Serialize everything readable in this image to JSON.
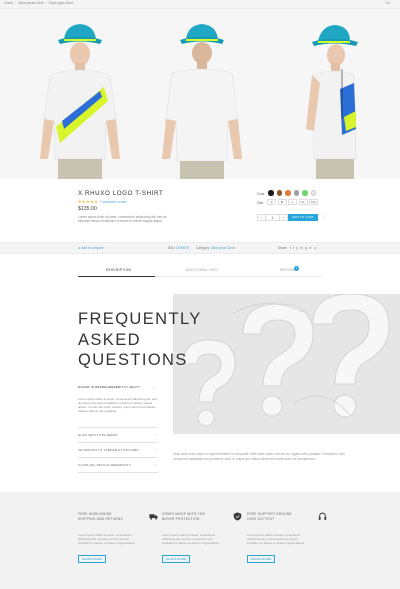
{
  "breadcrumb": {
    "items": [
      "Home",
      "Ultra Ipsum Dent",
      "Tulpa Ipgis Dent"
    ],
    "right_text": "1/4"
  },
  "product": {
    "title": "X RHUXO LOGO T-SHIRT",
    "stars": "★★★★★",
    "reviews": "1 customer review",
    "price": "$135.00",
    "description": "Lorem ipsum dolor sit amet, consectetur adipisicing elit, sed do eiusmod tempor incididunt ut labore et dolore magna aliqua.",
    "colors_label": "Color",
    "colors": [
      "#1a1a1a",
      "#8a5a2b",
      "#e07b3a",
      "#9aa0a6",
      "#6fd36b",
      "#e7e7e7"
    ],
    "sizes_label": "Size",
    "sizes": [
      "S",
      "M",
      "L",
      "XL",
      "XXL"
    ],
    "qty_minus": "−",
    "qty_value": "1",
    "qty_plus": "+",
    "add_to_cart": "ADD TO CART",
    "wishlist_icon": "♡"
  },
  "meta": {
    "compare": "⊕ Add to compare",
    "sku_label": "SKU:",
    "sku_value": "IXR0075",
    "category_label": "Category:",
    "category_value": "Ultra Ipsum Dent",
    "share_label": "Share:",
    "share_icons": [
      "f",
      "t",
      "p",
      "in",
      "g",
      "✉",
      "◎"
    ]
  },
  "tabs": {
    "items": [
      "DESCRIPTION",
      "ADDITIONAL INFO",
      "REVIEWS"
    ],
    "reviews_count": "1"
  },
  "faq": {
    "title_lines": [
      "FREQUENTLY",
      "ASKED",
      "QUESTIONS"
    ],
    "questions": [
      {
        "q": "DOLOR IN REPREHENDERIT IN VELIT?",
        "chevron": "⌄"
      },
      {
        "q": "ELAM VENI TOTE DEMO?",
        "chevron": "›"
      },
      {
        "q": "INCIDIDUNT UT LABORE ET DOLORE?",
        "chevron": "›"
      },
      {
        "q": "CULPA QUI OFFICIA DESERUNT?",
        "chevron": "›"
      }
    ],
    "answer": "Lorem ipsum dolor sit amet, consectetur adipiscing elit, sed do eiusmod tempor incididunt ut labore et dolore magna aliqua. Ut enim ad minim veniam, quis nostrud exercitation ullamco laboris nisi ut aliquip.",
    "body_text": "Duis aute irure dolor in reprehenderit in voluptate velit esse cillum dolore eu fugiat nulla pariatur. Excepteur sint occaecat cupidatat non proident, sunt in culpa qui officia deserunt mollit anim id est laborum."
  },
  "features": [
    {
      "title": "FREE WORLDWIDE SHIPPING AND RETURNS",
      "icon": "truck-icon",
      "desc": "Lorem ipsum dolor sit amet, consectetur adipiscing elit, sed do eiusmod tempor incididunt ut labore et dolore magna aliqua.",
      "button": "LEARN MORE"
    },
    {
      "title": "COMPLIANCE WITH THE BUYER PROTECTION",
      "icon": "shield-icon",
      "desc": "Lorem ipsum dolor sit amet, consectetur adipiscing elit, sed do eiusmod tempor incididunt ut labore et dolore magna aliqua.",
      "button": "LEARN MORE"
    },
    {
      "title": "FREE SUPPORT AROUND 24/00 24/7 EXIT",
      "icon": "headset-icon",
      "desc": "Lorem ipsum dolor sit amet, consectetur adipiscing elit, sed do eiusmod tempor incididunt ut labore et dolore magna aliqua.",
      "button": "LEARN MORE"
    }
  ]
}
